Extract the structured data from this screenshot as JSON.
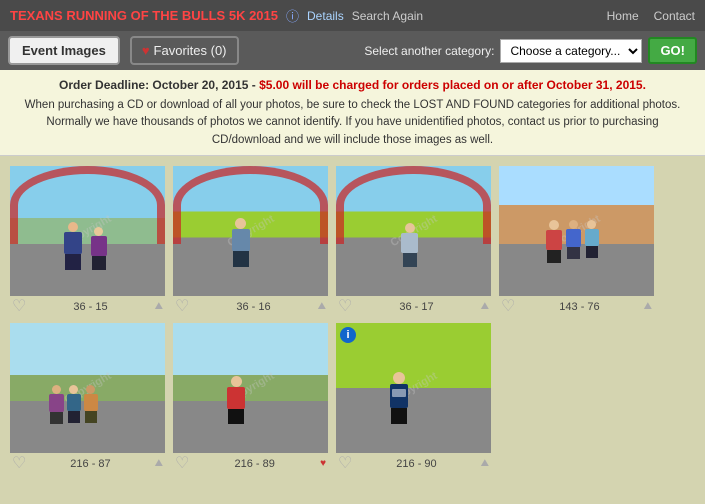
{
  "header": {
    "event_title": "TEXANS RUNNING OF THE BULLS 5K 2015",
    "details_label": "Details",
    "search_again_label": "Search Again",
    "home_label": "Home",
    "contact_label": "Contact"
  },
  "tabs": {
    "event_images_label": "Event Images",
    "favorites_label": "Favorites (0)",
    "select_category_label": "Select another category:",
    "category_placeholder": "Choose a category...",
    "go_label": "GO!"
  },
  "notice": {
    "line1": "Order Deadline: October 20, 2015 - $5.00 will be charged for orders placed on or after October 31, 2015.",
    "line2": "When purchasing a CD or download of all your photos, be sure to check the LOST AND FOUND categories for additional photos. Normally we have thousands of photos we cannot identify. If you have unidentified photos, contact us prior to purchasing CD/download and we will include those images as well."
  },
  "photos": [
    {
      "id": "photo-1",
      "caption": "36 - 15",
      "dark": false,
      "info_badge": false
    },
    {
      "id": "photo-2",
      "caption": "36 - 16",
      "dark": false,
      "info_badge": false
    },
    {
      "id": "photo-3",
      "caption": "36 - 17",
      "dark": false,
      "info_badge": false
    },
    {
      "id": "photo-4",
      "caption": "143 - 76",
      "dark": false,
      "info_badge": false
    },
    {
      "id": "photo-5",
      "caption": "216 - 87",
      "dark": false,
      "info_badge": false
    },
    {
      "id": "photo-6",
      "caption": "216 - 89",
      "dark": false,
      "info_badge": false
    },
    {
      "id": "photo-7",
      "caption": "216 - 90",
      "dark": true,
      "info_badge": true
    }
  ],
  "colors": {
    "accent_red": "#ff4444",
    "bg_dark": "#4a4a4a",
    "bg_medium": "#5a5a5a",
    "go_green": "#44aa44",
    "notice_bg": "#f5f5dc"
  }
}
